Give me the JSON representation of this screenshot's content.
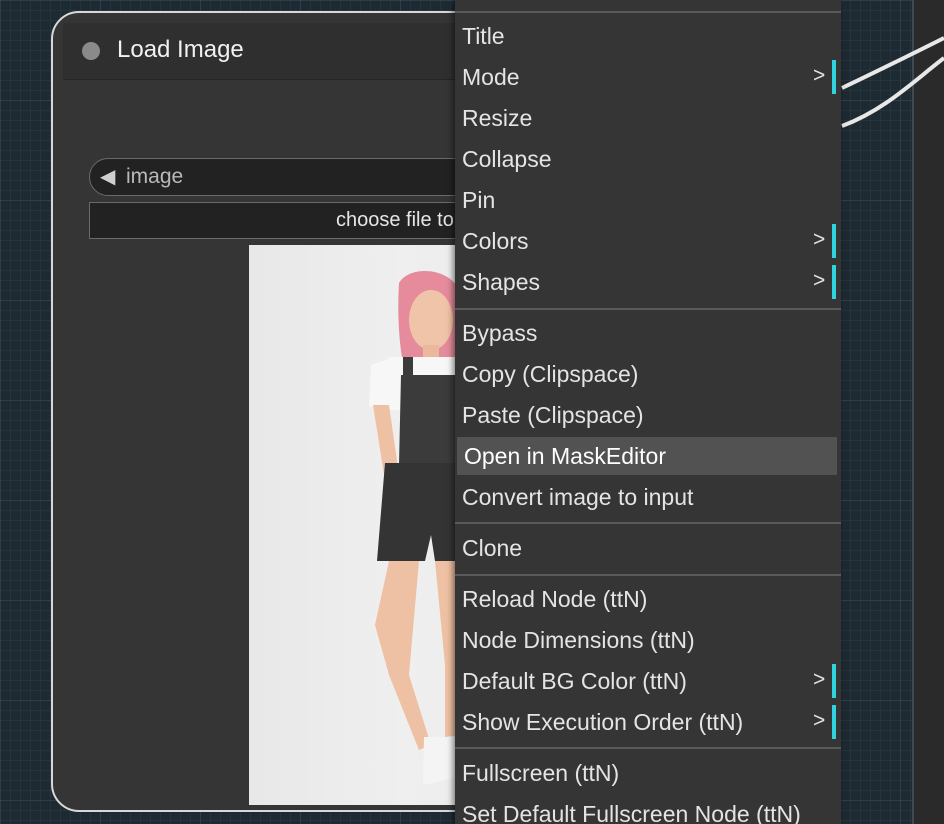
{
  "node": {
    "title": "Load Image",
    "combo": {
      "arrow": "◀",
      "label": "image"
    },
    "upload_button_label": "choose file to upload"
  },
  "context_menu": {
    "items": [
      {
        "label": "Title"
      },
      {
        "label": "Mode",
        "submenu": ">"
      },
      {
        "label": "Resize"
      },
      {
        "label": "Collapse"
      },
      {
        "label": "Pin"
      },
      {
        "label": "Colors",
        "submenu": ">"
      },
      {
        "label": "Shapes",
        "submenu": ">"
      },
      {
        "label": "Bypass"
      },
      {
        "label": "Copy (Clipspace)"
      },
      {
        "label": "Paste (Clipspace)"
      },
      {
        "label": "Open in MaskEditor",
        "highlighted": true
      },
      {
        "label": "Convert image to input"
      },
      {
        "label": "Clone"
      },
      {
        "label": "Reload Node (ttN)"
      },
      {
        "label": "Node Dimensions (ttN)"
      },
      {
        "label": "Default BG Color (ttN)",
        "submenu": ">"
      },
      {
        "label": "Show Execution Order (ttN)",
        "submenu": ">"
      },
      {
        "label": "Fullscreen (ttN)"
      },
      {
        "label": "Set Default Fullscreen Node (ttN)"
      }
    ]
  },
  "colors": {
    "canvas_bg": "#1e2a32",
    "node_bg": "#353535",
    "menu_bg": "#353535",
    "menu_highlight": "#525252",
    "submenu_accent": "#2fd4e0"
  }
}
